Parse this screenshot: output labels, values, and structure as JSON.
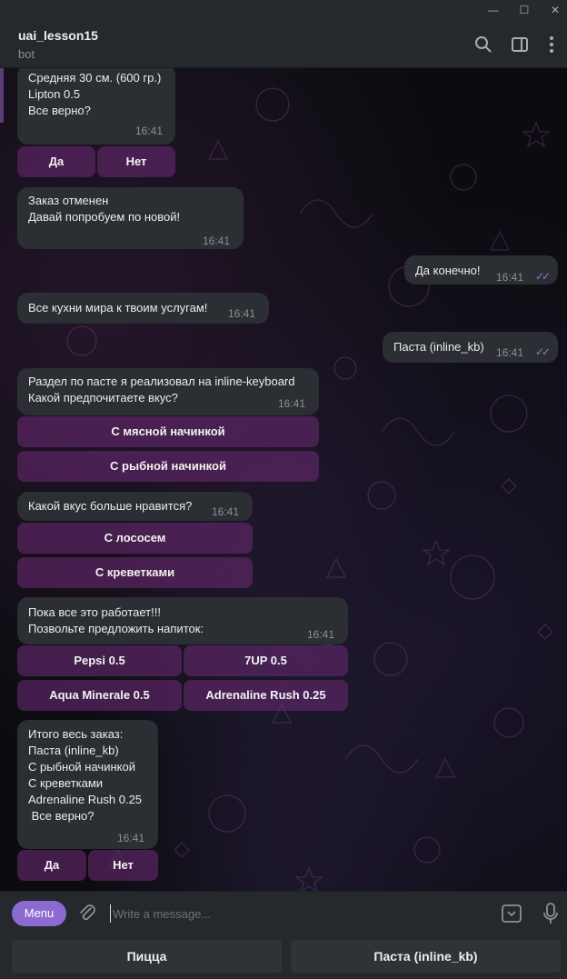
{
  "window": {
    "minimize": "—",
    "maximize": "☐",
    "close": "✕"
  },
  "header": {
    "title": "uai_lesson15",
    "subtitle": "bot",
    "icons": [
      "search-icon",
      "sidebar-toggle-icon",
      "more-vertical-icon"
    ]
  },
  "messages": {
    "m1": {
      "lines": [
        "Средняя 30 см. (600 гр.)",
        "Lipton 0.5",
        "",
        "Все верно?"
      ],
      "time": "16:41",
      "kb": [
        "Да",
        "Нет"
      ]
    },
    "m2": {
      "lines": [
        "Заказ отменен",
        "",
        "Давай попробуем по новой!"
      ],
      "time": "16:41"
    },
    "m3": {
      "text": "Да конечно!",
      "time": "16:41",
      "status": "✓✓"
    },
    "m4": {
      "text": "Все кухни мира к твоим услугам!",
      "time": "16:41"
    },
    "m5": {
      "text": "Паста (inline_kb)",
      "time": "16:41",
      "status": "✓✓"
    },
    "m6": {
      "lines": [
        "Раздел по пасте я реализовал на inline-keyboard",
        "Какой предпочитаете вкус?"
      ],
      "time": "16:41",
      "kb": [
        "С мясной начинкой",
        "С рыбной начинкой"
      ]
    },
    "m7": {
      "text": "Какой вкус больше нравится?",
      "time": "16:41",
      "kb": [
        "С лососем",
        "С креветками"
      ]
    },
    "m8": {
      "lines": [
        "Пока все это работает!!!",
        "Позвольте предложить напиток:"
      ],
      "time": "16:41",
      "kb": [
        "Pepsi 0.5",
        "7UP 0.5",
        "Aqua Minerale 0.5",
        "Adrenaline Rush 0.25"
      ]
    },
    "m9": {
      "lines": [
        "Итого весь заказ:",
        "Паста (inline_kb)",
        "С рыбной начинкой",
        "С креветками",
        "Adrenaline Rush 0.25",
        "",
        " Все верно?"
      ],
      "time": "16:41",
      "kb": [
        "Да",
        "Нет"
      ]
    }
  },
  "composer": {
    "menu": "Menu",
    "placeholder": "Write a message..."
  },
  "reply_keyboard": [
    "Пицца",
    "Паста (inline_kb)"
  ],
  "colors": {
    "accent": "#8b6bd0",
    "bubble": "#2b2e33",
    "inline_button": "#6a2a72",
    "header": "#25282d"
  }
}
